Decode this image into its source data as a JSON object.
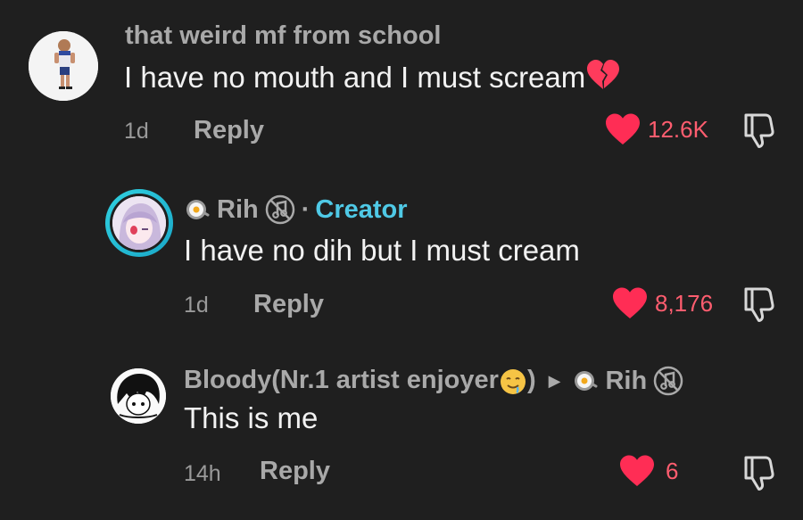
{
  "comments": [
    {
      "username": "that weird mf from school",
      "text": "I have no mouth and I must scream",
      "text_emoji": "broken-heart-icon",
      "age": "1d",
      "reply_label": "Reply",
      "likes": "12.6K"
    },
    {
      "username": "Rih",
      "separator": "·",
      "badge": "Creator",
      "text": "I have no dih but I must cream",
      "age": "1d",
      "reply_label": "Reply",
      "likes": "8,176"
    },
    {
      "username": "Bloody(Nr.1 artist enjoyer",
      "username_suffix": ")",
      "reply_to": "Rih",
      "text": "This is me",
      "age": "14h",
      "reply_label": "Reply",
      "likes": "6"
    }
  ],
  "colors": {
    "background": "#1f1f1f",
    "like": "#ff2d55",
    "creator": "#4fc9e6"
  }
}
